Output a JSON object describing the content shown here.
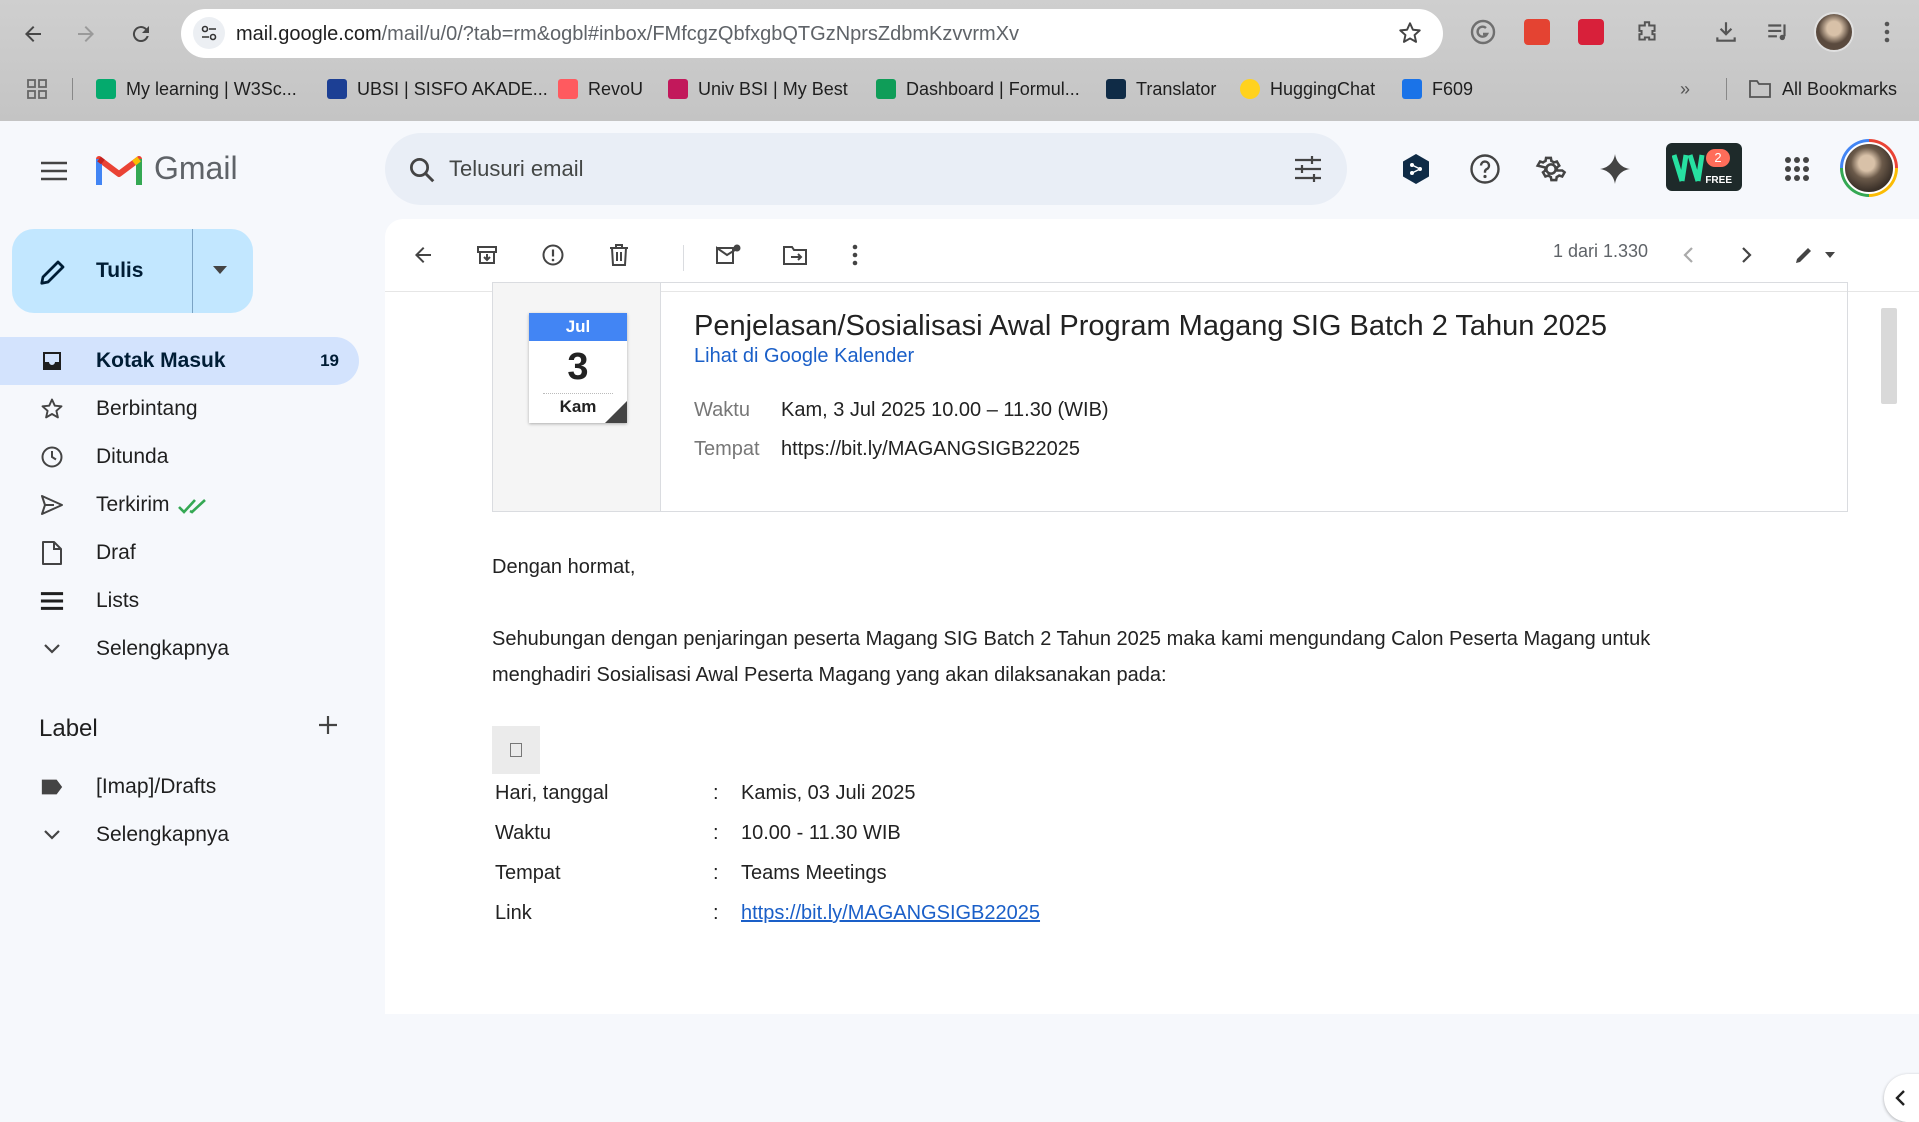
{
  "browser": {
    "url_host": "mail.google.com",
    "url_path": "/mail/u/0/?tab=rm&ogbl#inbox/FMfcgzQbfxgbQTGzNprsZdbmKzvvrmXv",
    "bookmarks": [
      {
        "label": "My learning | W3Sc...",
        "color": "#04aa6d"
      },
      {
        "label": "UBSI | SISFO AKADE...",
        "color": "#1c3f94"
      },
      {
        "label": "RevoU",
        "color": "#ff5a5f"
      },
      {
        "label": "Univ BSI | My Best",
        "color": "#c2185b"
      },
      {
        "label": "Dashboard | Formul...",
        "color": "#0f9d58"
      },
      {
        "label": "Translator",
        "color": "#0f2b46"
      },
      {
        "label": "HuggingChat",
        "color": "#ffd21e"
      },
      {
        "label": "F609",
        "color": "#1a73e8"
      }
    ],
    "bookmarks_more": "»",
    "all_bookmarks": "All Bookmarks"
  },
  "gmail": {
    "brand": "Gmail",
    "search_placeholder": "Telusuri email",
    "ext_badge_count": "2",
    "ext_badge_text": "FREE",
    "compose_label": "Tulis",
    "nav": [
      {
        "label": "Kotak Masuk",
        "count": "19",
        "icon": "inbox-icon"
      },
      {
        "label": "Berbintang",
        "count": "",
        "icon": "star-icon"
      },
      {
        "label": "Ditunda",
        "count": "",
        "icon": "clock-icon"
      },
      {
        "label": "Terkirim",
        "count": "",
        "icon": "send-icon"
      },
      {
        "label": "Draf",
        "count": "",
        "icon": "draft-icon"
      },
      {
        "label": "Lists",
        "count": "",
        "icon": "lists-icon"
      },
      {
        "label": "Selengkapnya",
        "count": "",
        "icon": "chevron-down-icon"
      }
    ],
    "label_heading": "Label",
    "labels": [
      {
        "label": "[Imap]/Drafts",
        "icon": "label-icon"
      },
      {
        "label": "Selengkapnya",
        "icon": "chevron-down-icon"
      }
    ]
  },
  "toolbar": {
    "pager": "1 dari 1.330"
  },
  "event": {
    "month": "Jul",
    "day": "3",
    "weekday": "Kam",
    "title": "Penjelasan/Sosialisasi Awal Program Magang SIG Batch 2 Tahun 2025",
    "calendar_link": "Lihat di Google Kalender",
    "time_label": "Waktu",
    "time_value": "Kam, 3 Jul 2025 10.00 – 11.30 (WIB)",
    "place_label": "Tempat",
    "place_value": "https://bit.ly/MAGANGSIGB22025"
  },
  "body": {
    "greeting": "Dengan hormat,",
    "para_line1": "Sehubungan dengan penjaringan peserta Magang SIG Batch 2 Tahun 2025 maka kami mengundang Calon Peserta Magang untuk",
    "para_line2": "menghadiri Sosialisasi Awal Peserta Magang yang akan dilaksanakan pada:",
    "details": [
      {
        "key": "Hari, tanggal",
        "value": "Kamis, 03 Juli 2025"
      },
      {
        "key": "Waktu",
        "value": "10.00 - 11.30 WIB"
      },
      {
        "key": "Tempat",
        "value": "Teams Meetings"
      },
      {
        "key": "Link",
        "value": "https://bit.ly/MAGANGSIGB22025"
      }
    ],
    "colon": ":"
  }
}
